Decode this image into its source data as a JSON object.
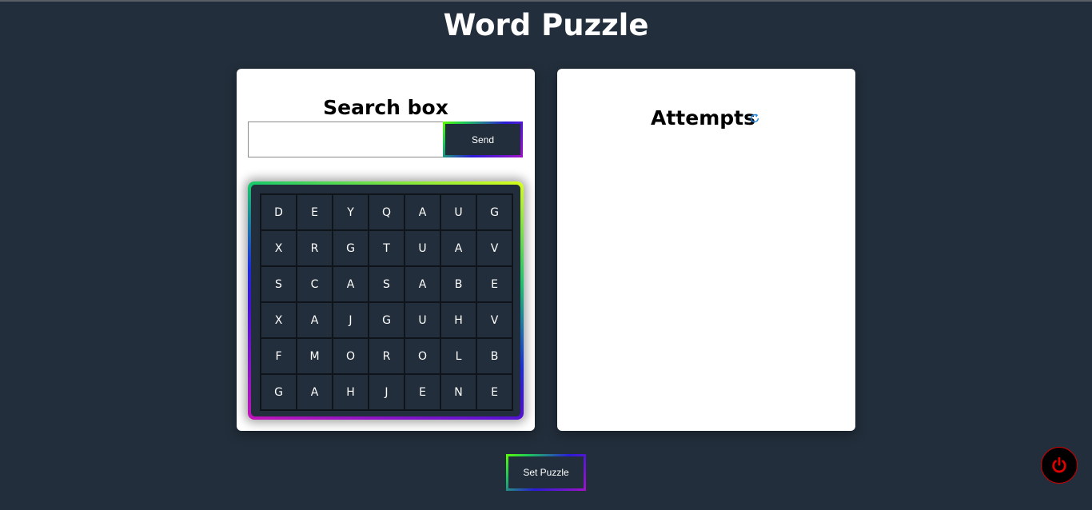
{
  "app": {
    "title": "Word Puzzle"
  },
  "search": {
    "heading": "Search box",
    "input_value": "",
    "placeholder": "",
    "send_label": "Send"
  },
  "grid": {
    "rows": [
      [
        "D",
        "E",
        "Y",
        "Q",
        "A",
        "U",
        "G"
      ],
      [
        "X",
        "R",
        "G",
        "T",
        "U",
        "A",
        "V"
      ],
      [
        "S",
        "C",
        "A",
        "S",
        "A",
        "B",
        "E"
      ],
      [
        "X",
        "A",
        "J",
        "G",
        "U",
        "H",
        "V"
      ],
      [
        "F",
        "M",
        "O",
        "R",
        "O",
        "L",
        "B"
      ],
      [
        "G",
        "A",
        "H",
        "J",
        "E",
        "N",
        "E"
      ]
    ]
  },
  "attempts": {
    "heading": "Attempts",
    "refresh_icon": "refresh-icon",
    "items": []
  },
  "footer": {
    "set_puzzle_label": "Set Puzzle",
    "power_icon": "power-icon"
  },
  "colors": {
    "background": "#222e3b",
    "card": "#ffffff",
    "accent_refresh": "#1e88e5",
    "power": "#e00000"
  }
}
